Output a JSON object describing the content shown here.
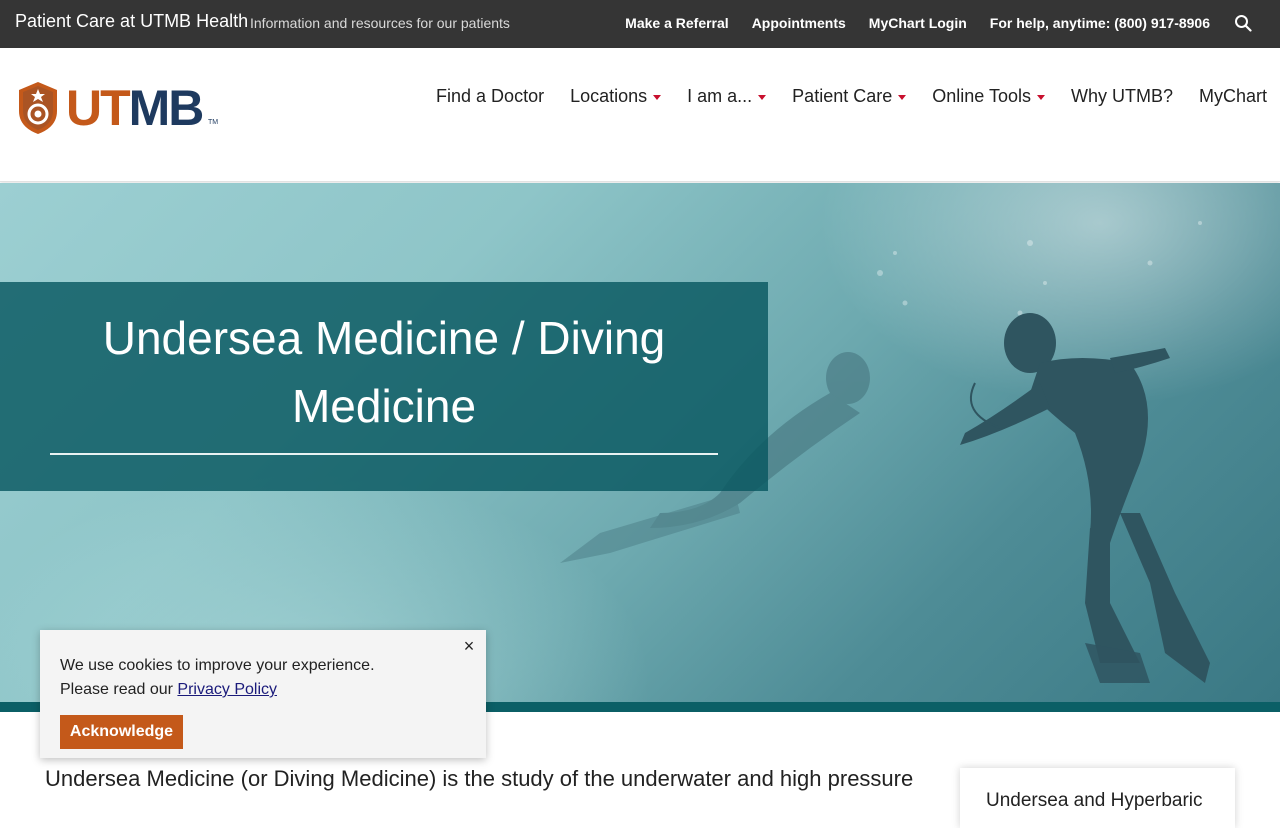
{
  "topbar": {
    "site_title": "Patient Care at UTMB Health",
    "tagline": "Information and resources for our patients",
    "links": [
      "Make a Referral",
      "Appointments",
      "MyChart Login"
    ],
    "help_text": "For help, anytime: (800) 917-8906",
    "search_icon": "search-icon"
  },
  "logo": {
    "part1": "UT",
    "part2": "MB",
    "tm": "TM",
    "colors": {
      "ut": "#c4591a",
      "mb": "#1e3a5f"
    }
  },
  "nav": {
    "items": [
      {
        "label": "Find a Doctor",
        "dropdown": false
      },
      {
        "label": "Locations",
        "dropdown": true
      },
      {
        "label": "I am a...",
        "dropdown": true
      },
      {
        "label": "Patient Care",
        "dropdown": true
      },
      {
        "label": "Online Tools",
        "dropdown": true
      },
      {
        "label": "Why UTMB?",
        "dropdown": false
      },
      {
        "label": "MyChart",
        "dropdown": false
      }
    ]
  },
  "hero": {
    "title": "Undersea Medicine / Diving Medicine",
    "panel_color": "#095860"
  },
  "content": {
    "intro": "Undersea Medicine (or Diving Medicine) is the study of the underwater and high pressure",
    "sidecard_title": "Undersea and Hyperbaric"
  },
  "cookie": {
    "line1": "We use cookies to improve your experience.",
    "line2_prefix": "Please read our",
    "privacy_link": "Privacy Policy",
    "close_symbol": "×",
    "button": "Acknowledge",
    "accent": "#c4591a"
  }
}
